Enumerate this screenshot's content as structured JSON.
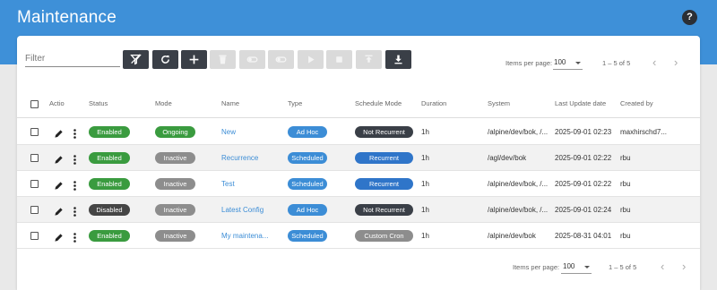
{
  "header": {
    "title": "Maintenance",
    "help_label": "?"
  },
  "filter": {
    "placeholder": "Filter"
  },
  "toolbar": {
    "buttons": [
      {
        "name": "clear-filter-button",
        "icon": "filter-off-icon",
        "enabled": true
      },
      {
        "name": "refresh-button",
        "icon": "refresh-icon",
        "enabled": true
      },
      {
        "name": "add-button",
        "icon": "plus-icon",
        "enabled": true
      },
      {
        "name": "delete-button",
        "icon": "trash-icon",
        "enabled": false
      },
      {
        "name": "toggle-on-button",
        "icon": "toggle-icon",
        "enabled": false
      },
      {
        "name": "toggle-off-button",
        "icon": "toggle-icon",
        "enabled": false
      },
      {
        "name": "start-button",
        "icon": "play-icon",
        "enabled": false
      },
      {
        "name": "stop-button",
        "icon": "stop-icon",
        "enabled": false
      },
      {
        "name": "upload-button",
        "icon": "upload-icon",
        "enabled": false
      },
      {
        "name": "download-button",
        "icon": "download-icon",
        "enabled": true
      }
    ]
  },
  "pagination_top": {
    "items_label": "Items per page:",
    "page_size": "100",
    "range": "1 – 5 of 5"
  },
  "pagination_bottom": {
    "items_label": "Items per page:",
    "page_size": "100",
    "range": "1 – 5 of 5"
  },
  "columns": [
    "Actio",
    "Status",
    "Mode",
    "Name",
    "Type",
    "Schedule Mode",
    "Duration",
    "System",
    "Last Update date",
    "Created by"
  ],
  "rows": [
    {
      "status": "Enabled",
      "mode": "Ongoing",
      "name": "New",
      "type": "Ad Hoc",
      "schedule": "Not Recurrent",
      "duration": "1h",
      "system": "/alpine/dev/bok, /...",
      "updated": "2025-09-01 02:23",
      "created_by": "maxhirschd7..."
    },
    {
      "status": "Enabled",
      "mode": "Inactive",
      "name": "Recurrence",
      "type": "Scheduled",
      "schedule": "Recurrent",
      "duration": "1h",
      "system": "/agl/dev/bok",
      "updated": "2025-09-01 02:22",
      "created_by": "rbu"
    },
    {
      "status": "Enabled",
      "mode": "Inactive",
      "name": "Test",
      "type": "Scheduled",
      "schedule": "Recurrent",
      "duration": "1h",
      "system": "/alpine/dev/bok, /...",
      "updated": "2025-09-01 02:22",
      "created_by": "rbu"
    },
    {
      "status": "Disabled",
      "mode": "Inactive",
      "name": "Latest Config",
      "type": "Ad Hoc",
      "schedule": "Not Recurrent",
      "duration": "1h",
      "system": "/alpine/dev/bok, /...",
      "updated": "2025-09-01 02:24",
      "created_by": "rbu"
    },
    {
      "status": "Enabled",
      "mode": "Inactive",
      "name": "My maintena...",
      "type": "Scheduled",
      "schedule": "Custom Cron",
      "duration": "1h",
      "system": "/alpine/dev/bok",
      "updated": "2025-08-31 04:01",
      "created_by": "rbu"
    }
  ],
  "colors": {
    "header": "#3e90d8",
    "enabled": "#3a9b3f",
    "disabled": "#454545",
    "ongoing": "#3a9b3f",
    "inactive": "#8d8d8d",
    "type": "#3c8dd6",
    "not_recurrent": "#3a3f47",
    "recurrent": "#2f75c9",
    "custom_cron": "#8d8d8d"
  }
}
